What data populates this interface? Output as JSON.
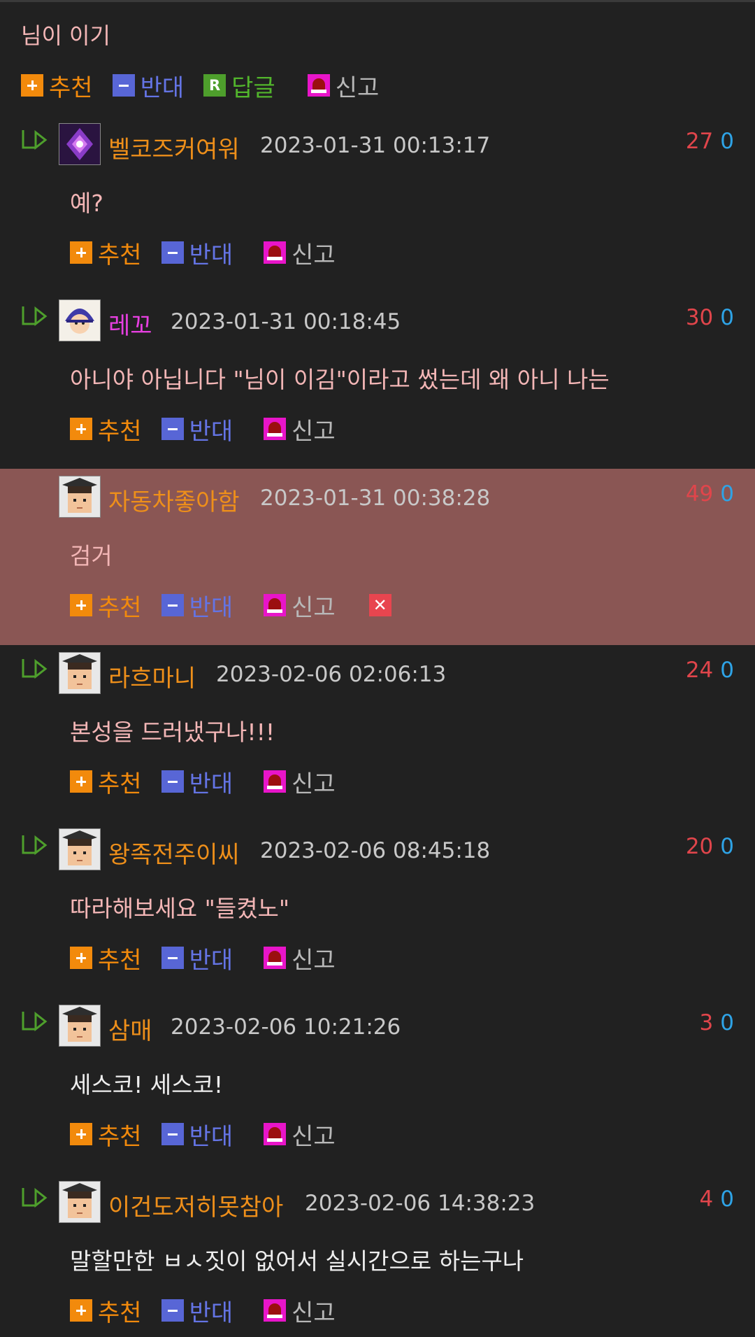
{
  "parent": {
    "text": "님이 이기",
    "actions": {
      "recommend": "추천",
      "oppose": "반대",
      "reply": "답글",
      "report": "신고"
    }
  },
  "actions": {
    "recommend": "추천",
    "oppose": "반대",
    "report": "신고"
  },
  "colors": {
    "background": "#212121",
    "highlight": "#8a5654",
    "nickname": "#ee8f1a",
    "recommend": "#f28a0c",
    "oppose": "#6474e4",
    "reply": "#52b52c",
    "report_icon": "#e815c9",
    "up_votes": "#e0454b",
    "down_votes": "#2ea3e6"
  },
  "comments": [
    {
      "nickname": "벨코즈커여워",
      "date": "2023-01-31 00:13:17",
      "up": "27",
      "down": "0",
      "text": "예?",
      "avatar": "purple-crystal-avatar"
    },
    {
      "nickname": "레꼬",
      "date": "2023-01-31 00:18:45",
      "up": "30",
      "down": "0",
      "text": "아니야 아닙니다 \"님이 이김\"이라고 썼는데 왜 아니 나는",
      "avatar": "wizard-avatar"
    },
    {
      "nickname": "자동차좋아함",
      "date": "2023-01-31 00:38:28",
      "up": "49",
      "down": "0",
      "text": "검거",
      "avatar": "graduate-avatar",
      "highlighted": true
    },
    {
      "nickname": "라흐마니",
      "date": "2023-02-06 02:06:13",
      "up": "24",
      "down": "0",
      "text": "본성을 드러냈구나!!!",
      "avatar": "graduate-avatar"
    },
    {
      "nickname": "왕족전주이씨",
      "date": "2023-02-06 08:45:18",
      "up": "20",
      "down": "0",
      "text": "따라해보세요 \"들켰노\"",
      "avatar": "graduate-avatar"
    },
    {
      "nickname": "삼매",
      "date": "2023-02-06 10:21:26",
      "up": "3",
      "down": "0",
      "text": "세스코! 세스코!",
      "avatar": "graduate-avatar"
    },
    {
      "nickname": "이건도저히못참아",
      "date": "2023-02-06 14:38:23",
      "up": "4",
      "down": "0",
      "text": "말할만한 ㅂㅅ짓이 없어서 실시간으로 하는구나",
      "avatar": "graduate-avatar"
    }
  ]
}
